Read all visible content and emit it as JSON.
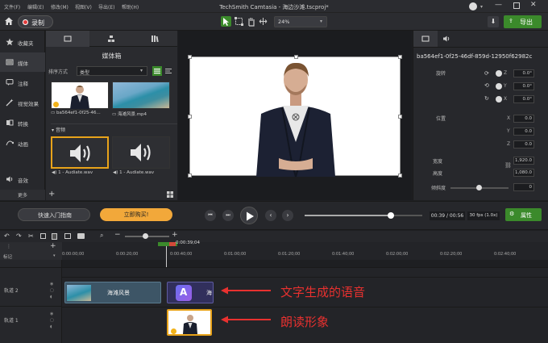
{
  "menu": [
    "文件(F)",
    "编辑(E)",
    "修改(M)",
    "视图(V)",
    "导出(E)",
    "帮助(H)"
  ],
  "window_title": "TechSmith Camtasia - 海边沙滩.tscproj*",
  "toolbar": {
    "record_label": "录制",
    "zoom_value": "24%",
    "export_label": "导出"
  },
  "nav": [
    "收藏夹",
    "媒体",
    "注释",
    "视觉效果",
    "转换",
    "动画",
    "音效"
  ],
  "nav_more": "更多",
  "bin": {
    "title": "媒体箱",
    "sort_label": "排序方式",
    "sort_value": "类型",
    "items": [
      "ba564ef1-0f25-46...",
      "海滩风景.mp4"
    ],
    "audio_section": "音频",
    "audio_items": [
      "1 - Audiate.wav",
      "1 - Audiate.wav"
    ]
  },
  "props": {
    "id": "ba564ef1-0f25-46df-859d-12950f62982c",
    "rotation_label": "旋转",
    "rotation": {
      "z": "0.0°",
      "y": "0.0°",
      "x": "0.0°"
    },
    "position_label": "位置",
    "position": {
      "x": "0.0",
      "y": "0.0",
      "z": "0.0"
    },
    "width_label": "宽度",
    "width": "1,920.0",
    "height_label": "高度",
    "height": "1,080.0",
    "tilt_label": "倾斜度",
    "tilt": "0",
    "axis": {
      "x": "X",
      "y": "Y",
      "z": "Z"
    }
  },
  "transport": {
    "quick_guide": "快速入门指南",
    "buy_now": "立即购买!",
    "time": "00:39 / 00:56",
    "fps": "30 fps (1.0x)",
    "properties_label": "属性",
    "progress": 0.73
  },
  "timeline": {
    "playhead": "0:00:39;04",
    "marker_label": "标记",
    "ticks": [
      "0:00:00;00",
      "0:00:20;00",
      "0:00:40;00",
      "0:01:00;00",
      "0:01:20;00",
      "0:01:40;00",
      "0:02:00;00",
      "0:02:20;00",
      "0:02:40;00"
    ],
    "track2_label": "轨道 2",
    "track1_label": "轨道 1",
    "clip_beach": "海滩风景",
    "clip_text_short": "海",
    "clip_avatar_letter": "A"
  },
  "annotations": {
    "speech": "文字生成的语音",
    "avatar": "朗读形象"
  },
  "colors": {
    "accent_green": "#3b8a2b",
    "buy_orange": "#f2a83a",
    "annotation_red": "#e8312f",
    "selection": "#e8a31a"
  }
}
